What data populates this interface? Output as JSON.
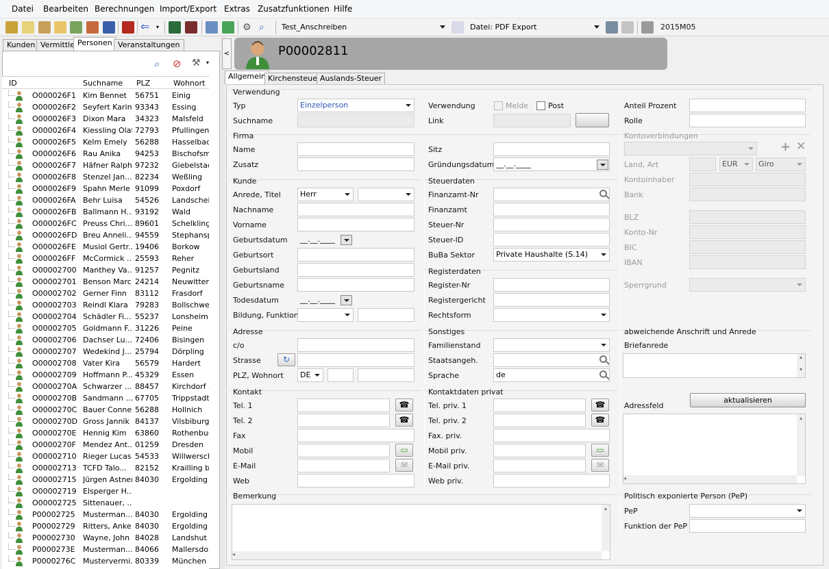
{
  "menu": [
    "Datei",
    "Bearbeiten",
    "Berechnungen",
    "Import/Export",
    "Extras",
    "Zusatzfunktionen",
    "Hilfe"
  ],
  "toolbar": {
    "template_combo": "Test_Anschreiben",
    "export_combo": "Datei: PDF Export",
    "period": "2015M05"
  },
  "left_tabs": [
    "Kunden",
    "Vermittler",
    "Personen",
    "Veranstaltungen"
  ],
  "grid": {
    "columns": [
      "ID",
      "Suchname",
      "PLZ",
      "Wohnort"
    ],
    "rows": [
      [
        "O000026F1",
        "Kim Bennet",
        "56751",
        "Einig"
      ],
      [
        "O000026F2",
        "Seyfert Karin",
        "93343",
        "Essing"
      ],
      [
        "O000026F3",
        "Dixon Mara",
        "34323",
        "Malsfeld"
      ],
      [
        "O000026F4",
        "Kiessling Olaf",
        "72793",
        "Pfullingen"
      ],
      [
        "O000026F5",
        "Kelm Emely",
        "56288",
        "Hasselbach"
      ],
      [
        "O000026F6",
        "Rau Anika",
        "94253",
        "Bischofsmai"
      ],
      [
        "O000026F7",
        "Häfner Ralph",
        "97232",
        "Giebelstadt"
      ],
      [
        "O000026F8",
        "Stenzel Jan...",
        "82234",
        "Weßling"
      ],
      [
        "O000026F9",
        "Spahn Merle",
        "91099",
        "Poxdorf"
      ],
      [
        "O000026FA",
        "Behr Luisa",
        "54526",
        "Landscheid"
      ],
      [
        "O000026FB",
        "Ballmann H...",
        "93192",
        "Wald"
      ],
      [
        "O000026FC",
        "Preuss Chri...",
        "89601",
        "Schelklinge"
      ],
      [
        "O000026FD",
        "Breu Anneli...",
        "94559",
        "Stephanspo"
      ],
      [
        "O000026FE",
        "Musiol Gertr...",
        "19406",
        "Borkow"
      ],
      [
        "O000026FF",
        "McCormick ...",
        "25593",
        "Reher"
      ],
      [
        "O00002700",
        "Manthey Va...",
        "91257",
        "Pegnitz"
      ],
      [
        "O00002701",
        "Benson Marc",
        "24214",
        "Neuwittenb"
      ],
      [
        "O00002702",
        "Gerner Finn",
        "83112",
        "Frasdorf"
      ],
      [
        "O00002703",
        "Reindl Klara",
        "79283",
        "Bollschweil"
      ],
      [
        "O00002704",
        "Schädler Fi...",
        "55237",
        "Lonsheim"
      ],
      [
        "O00002705",
        "Goldmann F...",
        "31226",
        "Peine"
      ],
      [
        "O00002706",
        "Dachser Lu...",
        "72406",
        "Bisingen"
      ],
      [
        "O00002707",
        "Wedekind J...",
        "25794",
        "Dörpling"
      ],
      [
        "O00002708",
        "Vater Kira",
        "56579",
        "Hardert"
      ],
      [
        "O00002709",
        "Hoffmann P...",
        "45329",
        "Essen"
      ],
      [
        "O0000270A",
        "Schwarzer ...",
        "88457",
        "Kirchdorf an"
      ],
      [
        "O0000270B",
        "Sandmann ...",
        "67705",
        "Trippstadt"
      ],
      [
        "O0000270C",
        "Bauer Conner",
        "56288",
        "Hollnich"
      ],
      [
        "O0000270D",
        "Gross Jannik",
        "84137",
        "Vilsbiburg"
      ],
      [
        "O0000270E",
        "Hennig Kim",
        "63860",
        "Rothenbuch"
      ],
      [
        "O0000270F",
        "Mendez Ant...",
        "01259",
        "Dresden"
      ],
      [
        "O00002710",
        "Rieger Lucas",
        "54533",
        "Willwersche"
      ],
      [
        "O00002713",
        "TCFD Talo...",
        "82152",
        "Krailling bei"
      ],
      [
        "O00002715",
        "Jürgen Astner",
        "84030",
        "Ergolding"
      ],
      [
        "O00002719",
        "Elsperger H...",
        "",
        ""
      ],
      [
        "O00002725",
        "Sittenauer, ...",
        "",
        ""
      ],
      [
        "P00002725",
        "Musterman...",
        "84030",
        "Ergolding"
      ],
      [
        "P00002729",
        "Ritters, Anke",
        "84030",
        "Ergolding"
      ],
      [
        "P00002730",
        "Wayne, John",
        "84028",
        "Landshut"
      ],
      [
        "P0000273E",
        "Musterman...",
        "84066",
        "Mallersdorf-"
      ],
      [
        "P0000276C",
        "Mustervermi...",
        "80339",
        "München"
      ]
    ]
  },
  "header": {
    "id": "P00002811"
  },
  "right_tabs": [
    "Allgemein",
    "Kirchensteuer",
    "Auslands-Steuer"
  ],
  "form": {
    "verwendung": {
      "title": "Verwendung",
      "typ_label": "Typ",
      "typ_value": "Einzelperson",
      "suchname_label": "Suchname",
      "verwendung_label": "Verwendung",
      "melde_label": "Melde",
      "post_label": "Post",
      "link_label": "Link",
      "anteil_label": "Anteil Prozent",
      "rolle_label": "Rolle"
    },
    "firma": {
      "title": "Firma",
      "name_label": "Name",
      "zusatz_label": "Zusatz",
      "sitz_label": "Sitz",
      "gruendung_label": "Gründungsdatum",
      "gruendung_value": "__.__.____"
    },
    "kunde": {
      "title": "Kunde",
      "anrede_label": "Anrede, Titel",
      "anrede_value": "Herr",
      "nachname_label": "Nachname",
      "vorname_label": "Vorname",
      "geburtsdatum_label": "Geburtsdatum",
      "geburtsdatum_value": "__.__.____",
      "geburtsort_label": "Geburtsort",
      "geburtsland_label": "Geburtsland",
      "geburtsname_label": "Geburtsname",
      "todesdatum_label": "Todesdatum",
      "todesdatum_value": "__.__.____",
      "bildung_label": "Bildung, Funktion"
    },
    "steuer": {
      "title": "Steuerdaten",
      "finanzamt_nr_label": "Finanzamt-Nr",
      "finanzamt_label": "Finanzamt",
      "steuer_nr_label": "Steuer-Nr",
      "steuer_id_label": "Steuer-ID",
      "buba_label": "BuBa Sektor",
      "buba_value": "Private Haushalte (S.14)"
    },
    "register": {
      "title": "Registerdaten",
      "register_nr_label": "Register-Nr",
      "gericht_label": "Registergericht",
      "rechtsform_label": "Rechtsform"
    },
    "adresse": {
      "title": "Adresse",
      "co_label": "c/o",
      "strasse_label": "Strasse",
      "plz_label": "PLZ, Wohnort",
      "land_value": "DE"
    },
    "sonstiges": {
      "title": "Sonstiges",
      "familienstand_label": "Familienstand",
      "staatsangeh_label": "Staatsangeh.",
      "sprache_label": "Sprache",
      "sprache_value": "de"
    },
    "kontakt": {
      "title": "Kontakt",
      "tel1_label": "Tel. 1",
      "tel2_label": "Tel. 2",
      "fax_label": "Fax",
      "mobil_label": "Mobil",
      "email_label": "E-Mail",
      "web_label": "Web"
    },
    "kontakt_privat": {
      "title": "Kontaktdaten privat",
      "tel1_label": "Tel. priv. 1",
      "tel2_label": "Tel. priv. 2",
      "fax_label": "Fax. priv.",
      "mobil_label": "Mobil priv.",
      "email_label": "E-Mail priv.",
      "web_label": "Web priv."
    },
    "bemerkung": {
      "title": "Bemerkung"
    },
    "konto": {
      "title": "Kontoverbindungen",
      "land_label": "Land, Art",
      "currency": "EUR",
      "art": "Giro",
      "inhaber_label": "Kontoinhaber",
      "bank_label": "Bank",
      "blz_label": "BLZ",
      "konto_nr_label": "Konto-Nr",
      "bic_label": "BIC",
      "iban_label": "IBAN",
      "sperrgrund_label": "Sperrgrund"
    },
    "anschrift": {
      "title": "abweichende Anschrift und Anrede",
      "briefanrede_label": "Briefanrede",
      "adressfeld_label": "Adressfeld",
      "update_button": "aktualisieren"
    },
    "pep": {
      "title": "Politisch exponierte Person (PeP)",
      "pep_label": "PeP",
      "funktion_label": "Funktion der PeP"
    }
  }
}
